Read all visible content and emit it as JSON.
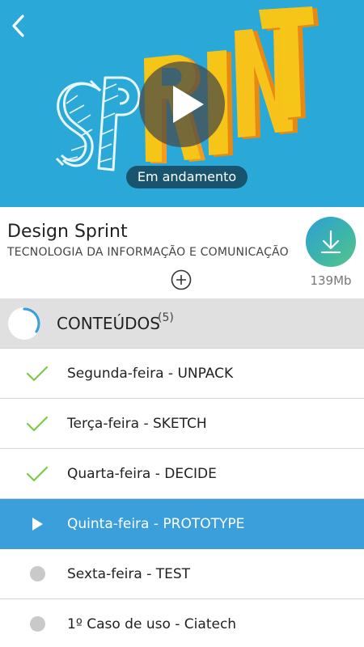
{
  "hero": {
    "art_text": "SPRINT",
    "status": "Em andamento",
    "colors": {
      "background": "#2aa9d8",
      "letters_yellow": "#f5c518",
      "letters_orange": "#f39c1f"
    }
  },
  "course": {
    "title": "Design Sprint",
    "category": "TECNOLOGIA DA INFORMAÇÃO E COMUNICAÇÃO",
    "download_size": "139Mb"
  },
  "section": {
    "title": "CONTEÚDOS",
    "count": "(5)"
  },
  "items": [
    {
      "label": "Segunda-feira - UNPACK",
      "state": "done"
    },
    {
      "label": "Terça-feira - SKETCH",
      "state": "done"
    },
    {
      "label": "Quarta-feira - DECIDE",
      "state": "done"
    },
    {
      "label": "Quinta-feira - PROTOTYPE",
      "state": "current"
    },
    {
      "label": "Sexta-feira - TEST",
      "state": "pending"
    },
    {
      "label": "1º Caso de uso - Ciatech",
      "state": "pending"
    }
  ],
  "icons": {
    "back": "chevron-left-icon",
    "play": "play-icon",
    "add": "plus-circle-icon",
    "download": "download-icon",
    "done": "check-icon",
    "current": "play-triangle-icon",
    "pending": "dot-icon"
  },
  "accent": "#3b9fdb",
  "check_color": "#7cc94a"
}
